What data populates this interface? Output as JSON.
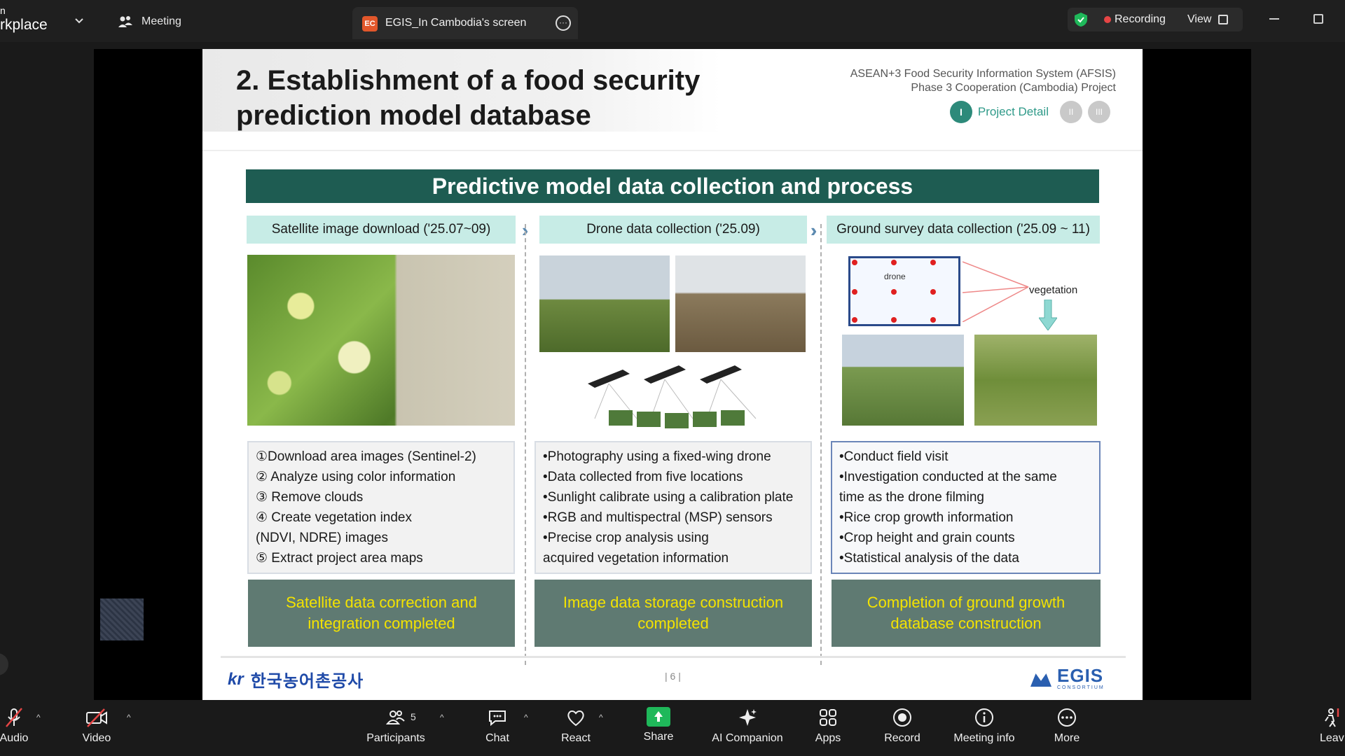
{
  "window": {
    "app_name": "rkplace",
    "app_name_top": "n",
    "meeting_tab": "Meeting",
    "share_tab": {
      "badge": "EC",
      "title": "EGIS_In Cambodia's screen"
    },
    "recording_label": "Recording",
    "view_label": "View"
  },
  "slide": {
    "title": "2. Establishment of a food security prediction model database",
    "afsis_line1": "ASEAN+3 Food Security Information System (AFSIS)",
    "afsis_line2": "Phase 3 Cooperation (Cambodia) Project",
    "nav": {
      "i": "I",
      "label": "Project Detail",
      "ii": "II",
      "iii": "III"
    },
    "banner": "Predictive model data collection and process",
    "steps": [
      {
        "label": "Satellite image download ('25.07~09)"
      },
      {
        "label": "Drone data collection ('25.09)"
      },
      {
        "label": "Ground survey data collection ('25.09 ~ 11)"
      }
    ],
    "diagram": {
      "drone_label": "drone",
      "vegetation_label": "vegetation"
    },
    "columns": [
      {
        "items": [
          "①Download area images (Sentinel-2)",
          "② Analyze using color information",
          "③ Remove clouds",
          "④ Create vegetation index\n   (NDVI, NDRE) images",
          "⑤ Extract project area maps"
        ],
        "result": "Satellite data correction and integration completed"
      },
      {
        "items": [
          "•Photography using a fixed-wing drone",
          "•Data collected from five locations",
          "•Sunlight calibrate using a calibration plate",
          "•RGB and multispectral (MSP) sensors",
          "•Precise crop analysis using\n  acquired vegetation information"
        ],
        "result": "Image data storage construction completed"
      },
      {
        "items": [
          "•Conduct field visit",
          "•Investigation conducted at the same\n time as the drone filming",
          "•Rice crop growth information",
          "•Crop height and grain counts",
          "•Statistical analysis of the data"
        ],
        "result": "Completion of ground growth database construction"
      }
    ],
    "footer": {
      "krc_mark": "kr",
      "krc_text": "한국농어촌공사",
      "page_number": "| 6 |",
      "egis_text": "EGIS",
      "egis_sub": "CONSORTIUM"
    }
  },
  "toolbar": {
    "audio": "Audio",
    "video": "Video",
    "participants": "Participants",
    "participants_count": "5",
    "chat": "Chat",
    "react": "React",
    "share": "Share",
    "ai_companion": "AI Companion",
    "apps": "Apps",
    "record": "Record",
    "meeting_info": "Meeting info",
    "more": "More",
    "leave": "Leav"
  },
  "colors": {
    "banner": "#1e5c52",
    "step_bg": "#c7ece6",
    "result_bg": "#5f7a72",
    "result_text": "#f4e300",
    "share_green": "#1fb85a",
    "recording_red": "#e64545"
  }
}
